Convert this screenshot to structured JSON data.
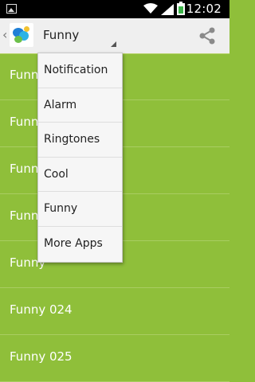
{
  "status_bar": {
    "time": "12:02"
  },
  "action_bar": {
    "title": "Funny"
  },
  "list": {
    "items": [
      {
        "label": "Funny"
      },
      {
        "label": "Funny"
      },
      {
        "label": "Funny"
      },
      {
        "label": "Funny"
      },
      {
        "label": "Funny"
      },
      {
        "label": "Funny 024"
      },
      {
        "label": "Funny 025"
      }
    ]
  },
  "dropdown": {
    "items": [
      {
        "label": "Notification"
      },
      {
        "label": "Alarm"
      },
      {
        "label": "Ringtones"
      },
      {
        "label": "Cool"
      },
      {
        "label": "Funny"
      },
      {
        "label": "More Apps"
      }
    ]
  },
  "colors": {
    "list_background": "#8fbf3a",
    "action_bar": "#efefef",
    "dropdown": "#f6f6f6"
  }
}
